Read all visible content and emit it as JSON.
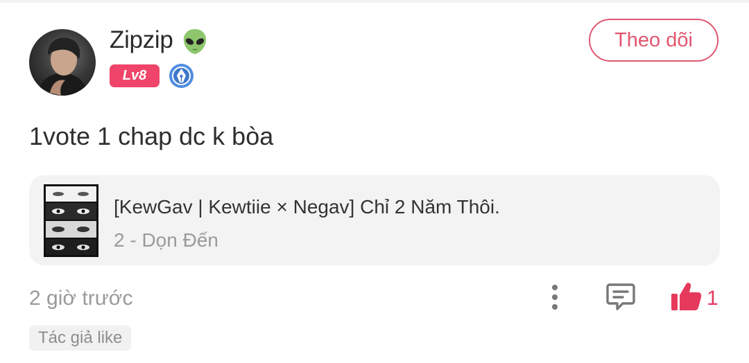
{
  "comment": {
    "user": {
      "name": "Zipzip",
      "avatar_icon": "avatar-photo",
      "emoji_icon": "alien-icon",
      "level": "Lv8",
      "badge_icon": "pen-nib-badge-icon",
      "level_color": "#f0456a"
    },
    "follow_label": "Theo dõi",
    "text": "1vote 1 chap dc k bòa",
    "chapter": {
      "title": "[KewGav | Kewtiie × Negav] Chỉ 2 Năm Thôi.",
      "subtitle": "2 - Dọn Đến"
    },
    "timestamp": "2 giờ trước",
    "like_count": "1",
    "tag": "Tác giả like",
    "accent_color": "#e63a5d"
  }
}
